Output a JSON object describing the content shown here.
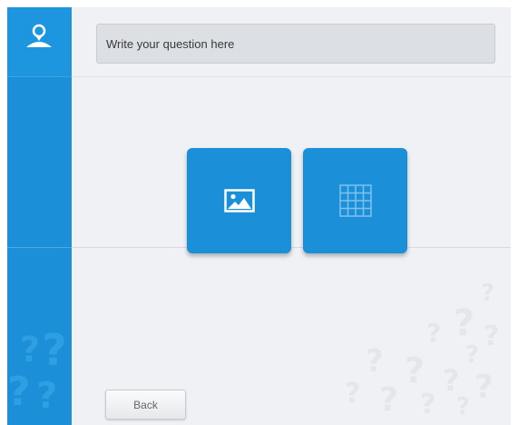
{
  "colors": {
    "brand_blue": "#1b8fd8",
    "content_bg": "#f0f1f4",
    "input_bg": "#dcdfe4"
  },
  "logo": {
    "icon": "map-pin-person-icon"
  },
  "question": {
    "placeholder": "Write your question here",
    "value": ""
  },
  "tiles": [
    {
      "icon": "image-icon"
    },
    {
      "icon": "grid-icon"
    }
  ],
  "footer": {
    "back_label": "Back"
  },
  "decorations": {
    "question_mark_glyph": "?"
  }
}
